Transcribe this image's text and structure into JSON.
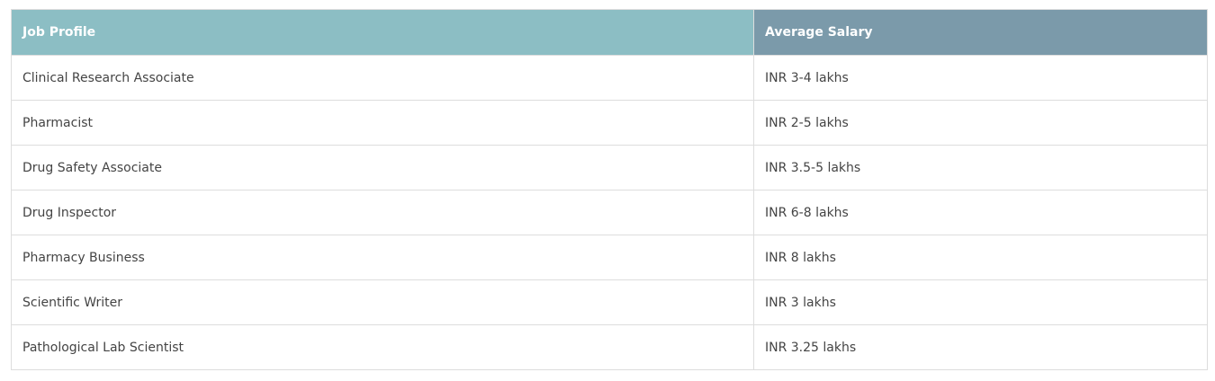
{
  "table": {
    "headers": [
      "Job Profile",
      "Average Salary"
    ],
    "rows": [
      [
        "Clinical Research Associate",
        "INR 3-4 lakhs"
      ],
      [
        "Pharmacist",
        "INR 2-5 lakhs"
      ],
      [
        "Drug Safety Associate",
        "INR 3.5-5 lakhs"
      ],
      [
        "Drug Inspector",
        "INR 6-8 lakhs"
      ],
      [
        "Pharmacy Business",
        "INR 8 lakhs"
      ],
      [
        "Scientific Writer",
        "INR 3 lakhs"
      ],
      [
        "Pathological Lab Scientist",
        "INR 3.25 lakhs"
      ]
    ]
  },
  "colors": {
    "header_job_profile_bg": "#8cbec4",
    "header_salary_bg": "#7b9aaa",
    "border": "#dddddd",
    "text": "#444444"
  }
}
